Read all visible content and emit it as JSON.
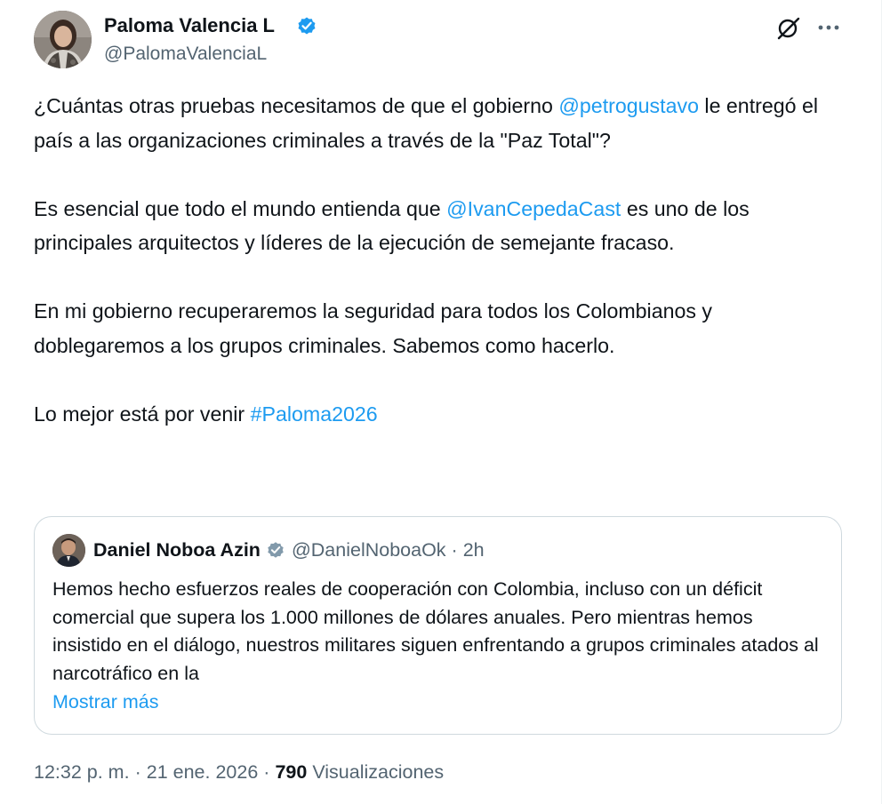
{
  "author": {
    "name": "Paloma Valencia L",
    "handle": "@PalomaValenciaL",
    "verified_color": "#1d9bf0"
  },
  "actions": {
    "grok_icon": "grok-icon",
    "more_icon": "more-dots-icon"
  },
  "tweet": {
    "p1_a": "¿Cuántas otras pruebas necesitamos de que el gobierno ",
    "p1_mention": "@petrogustavo",
    "p1_b": " le entregó el país a las organizaciones criminales a través de la \"Paz Total\"?",
    "p2_a": "Es esencial que todo el mundo entienda que ",
    "p2_mention": "@IvanCepedaCast",
    "p2_b": " es uno de los principales arquitectos y líderes de la ejecución de semejante fracaso.",
    "p3": "En mi gobierno recuperaremos la seguridad para todos los Colombianos y doblegaremos a los grupos criminales.  Sabemos como hacerlo.",
    "p4_a": "Lo mejor está por venir ",
    "p4_hashtag": "#Paloma2026"
  },
  "quote": {
    "name": "Daniel Noboa Azin",
    "handle": "@DanielNoboaOk",
    "separator": "·",
    "time": "2h",
    "text": "Hemos hecho esfuerzos reales de cooperación con Colombia, incluso con un déficit comercial que supera los 1.000 millones de dólares anuales. Pero mientras hemos insistido en el diálogo, nuestros militares siguen enfrentando a grupos criminales atados al narcotráfico en la",
    "show_more": "Mostrar más",
    "verified_color": "#829aab"
  },
  "meta": {
    "time": "12:32 p. m.",
    "sep1": "·",
    "date": "21 ene. 2026",
    "sep2": "·",
    "views_count": "790",
    "views_label": "Visualizaciones"
  },
  "colors": {
    "link": "#1d9bf0",
    "text": "#0f1419",
    "secondary": "#536471",
    "border": "#cfd9de"
  }
}
